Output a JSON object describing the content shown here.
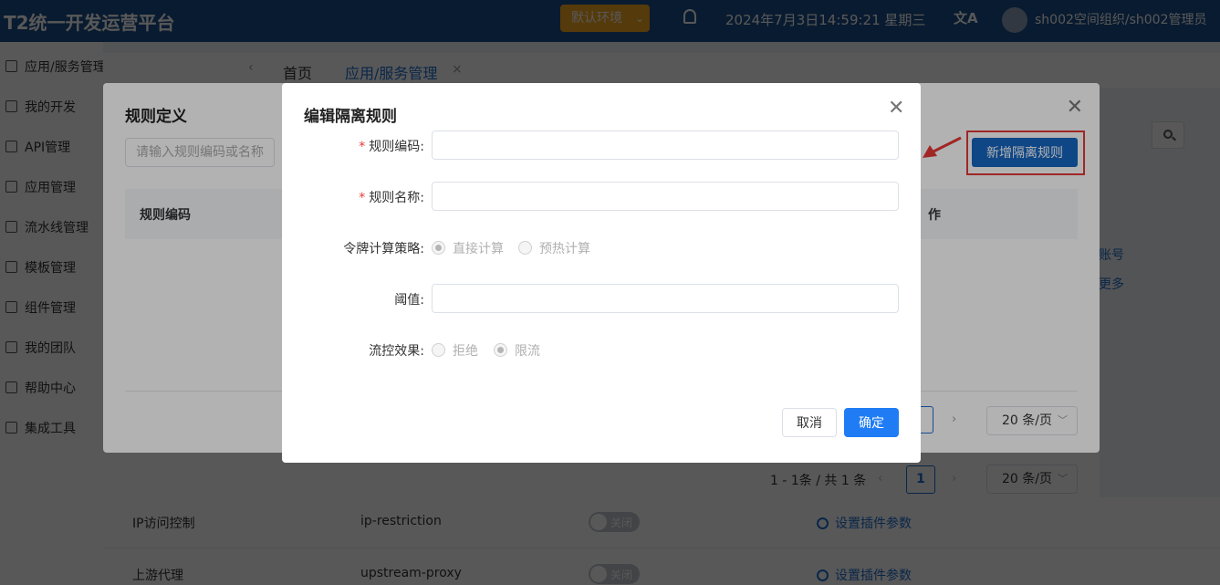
{
  "app": {
    "title": "T2统一开发运营平台",
    "env_select": "默认环境",
    "datetime": "2024年7月3日14:59:21 星期三",
    "user": "sh002空间组织/sh002管理员"
  },
  "sidebar": {
    "items": [
      {
        "label": "应用/服务管理",
        "icon": "app-service-icon"
      },
      {
        "label": "我的开发",
        "icon": "dev-icon"
      },
      {
        "label": "API管理",
        "icon": "api-icon"
      },
      {
        "label": "应用管理",
        "icon": "app-icon"
      },
      {
        "label": "流水线管理",
        "icon": "pipeline-icon"
      },
      {
        "label": "模板管理",
        "icon": "template-icon"
      },
      {
        "label": "组件管理",
        "icon": "component-icon"
      },
      {
        "label": "我的团队",
        "icon": "team-icon"
      },
      {
        "label": "帮助中心",
        "icon": "help-icon"
      },
      {
        "label": "集成工具",
        "icon": "tools-icon"
      }
    ]
  },
  "tabs": {
    "home": "首页",
    "app": "应用/服务管理",
    "close": "×"
  },
  "background": {
    "right_fragments": [
      "账号",
      "更多"
    ],
    "pagination": {
      "total": "1 - 1条 / 共 1 条",
      "page": "1",
      "page_size": "20 条/页"
    },
    "plugins": [
      {
        "name": "IP访问控制",
        "code": "ip-restriction",
        "switch": "关闭",
        "link": "设置插件参数"
      },
      {
        "name": "上游代理",
        "code": "upstream-proxy",
        "switch": "关闭",
        "link": "设置插件参数"
      }
    ]
  },
  "rule_dialog": {
    "title": "规则定义",
    "search_placeholder": "请输入规则编码或名称",
    "add_button": "新增隔离规则",
    "col_code": "规则编码",
    "col_op": "作",
    "page_size": "20 条/页",
    "accent": "#1565c0",
    "highlight": "#e53935"
  },
  "edit_dialog": {
    "title": "编辑隔离规则",
    "required_mark": "*",
    "fields": {
      "code_label": "规则编码:",
      "name_label": "规则名称:",
      "token_label": "令牌计算策略:",
      "token_options": [
        "直接计算",
        "预热计算"
      ],
      "token_selected": "直接计算",
      "threshold_label": "阈值:",
      "effect_label": "流控效果:",
      "effect_options": [
        "拒绝",
        "限流"
      ],
      "effect_selected": "限流"
    },
    "cancel": "取消",
    "ok": "确定",
    "ok_color": "#1f7cf5"
  }
}
